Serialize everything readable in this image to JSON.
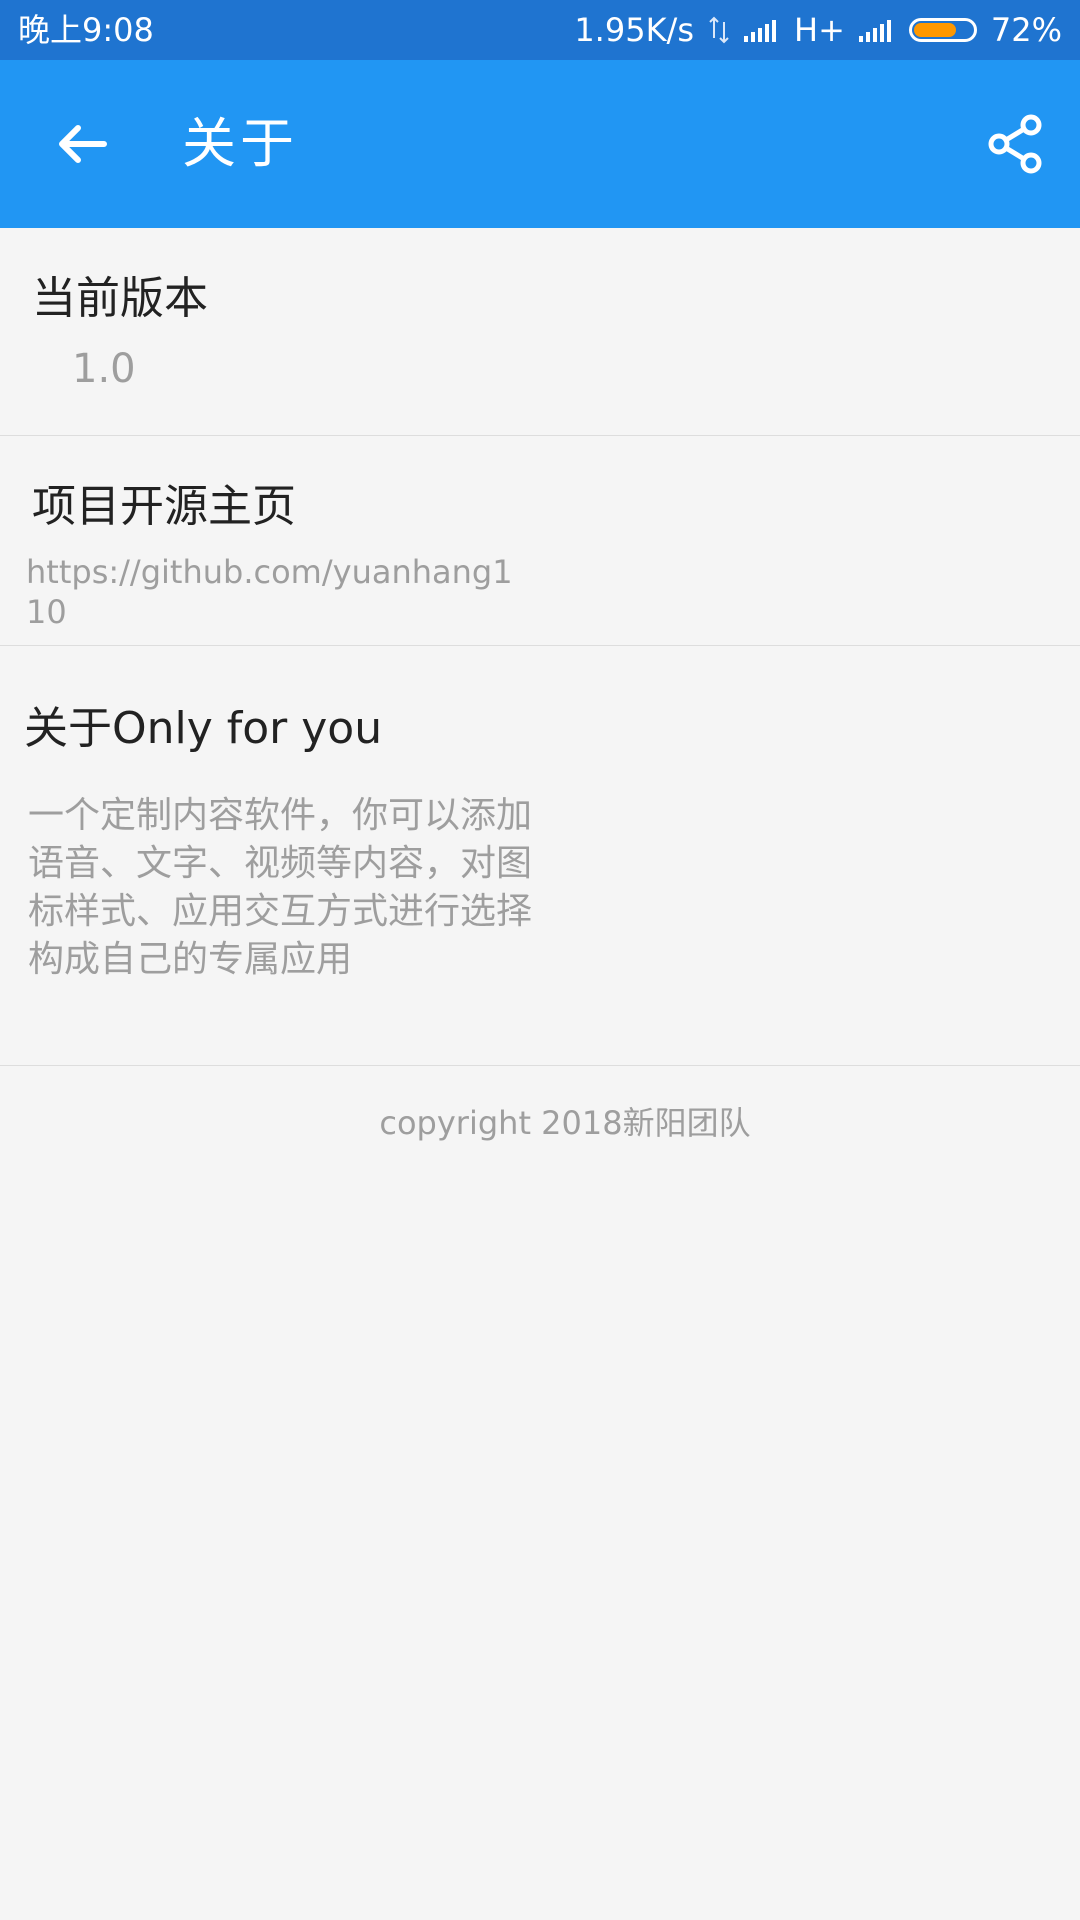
{
  "status_bar": {
    "time": "晚上9:08",
    "speed": "1.95K/s",
    "network": "H+",
    "battery": "72%"
  },
  "app_bar": {
    "title": "关于"
  },
  "sections": {
    "version": {
      "title": "当前版本",
      "value": "1.0"
    },
    "github": {
      "title": "项目开源主页",
      "value_line1": "https://github.com/yuanhang1",
      "value_line2": "10"
    },
    "about": {
      "title": "关于Only for you",
      "line1": "一个定制内容软件，你可以添加",
      "line2": "语音、文字、视频等内容，对图",
      "line3": "标样式、应用交互方式进行选择",
      "line4": "构成自己的专属应用"
    }
  },
  "footer": {
    "copyright": "copyright 2018新阳团队"
  },
  "colors": {
    "status_bar": "#1f74d0",
    "app_bar": "#2196f3",
    "battery_fill": "#ff9800"
  },
  "icons": {
    "back": "arrow-left-icon",
    "share": "share-icon",
    "signal": "signal-icon",
    "battery": "battery-icon",
    "transfer": "data-transfer-icon"
  }
}
